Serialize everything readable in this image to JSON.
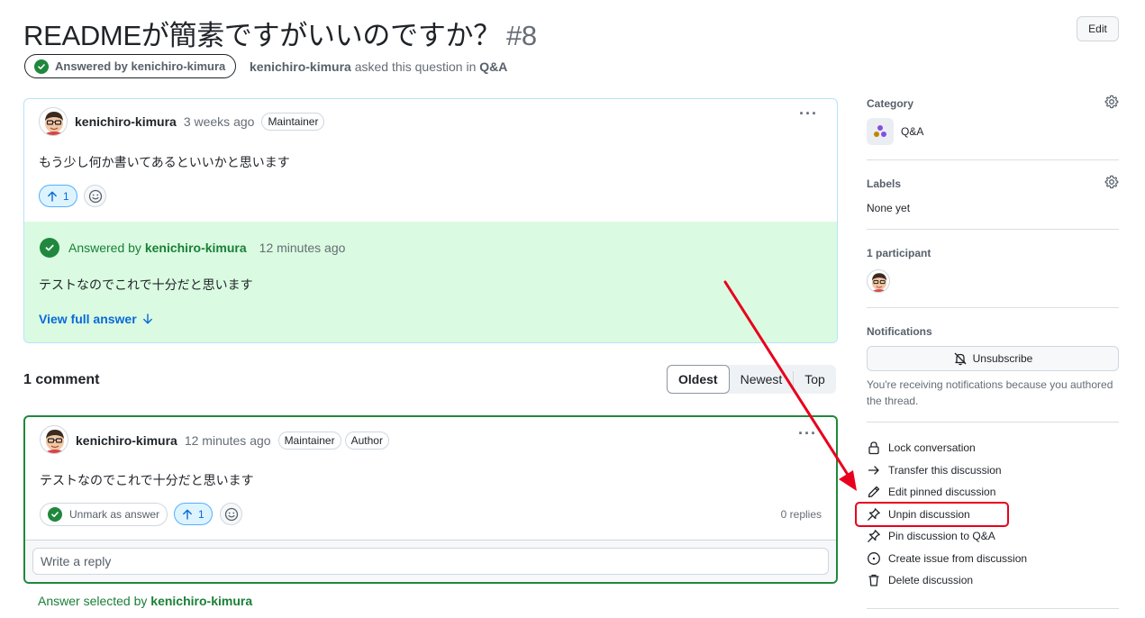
{
  "header": {
    "title": "READMEが簡素ですがいいのですか？",
    "number": "#8",
    "edit_label": "Edit",
    "answered_badge": "Answered by kenichiro-kimura",
    "author": "kenichiro-kimura",
    "asked_text": " asked this question in ",
    "category": "Q&A"
  },
  "question": {
    "author": "kenichiro-kimura",
    "time": "3 weeks ago",
    "badge": "Maintainer",
    "more_icon": "kebab-horizontal-icon",
    "body": "もう少し何か書いてあるといいかと思います",
    "upvotes": "1",
    "answer": {
      "prefix": "Answered by ",
      "author": "kenichiro-kimura",
      "time": "12 minutes ago",
      "body": "テストなのでこれで十分だと思います",
      "view_full": "View full answer"
    }
  },
  "comments": {
    "title": "1 comment",
    "sort": [
      "Oldest",
      "Newest",
      "Top"
    ],
    "items": [
      {
        "author": "kenichiro-kimura",
        "time": "12 minutes ago",
        "badges": [
          "Maintainer",
          "Author"
        ],
        "body": "テストなのでこれで十分だと思います",
        "unmark_label": "Unmark as answer",
        "upvotes": "1",
        "replies": "0 replies",
        "reply_placeholder": "Write a reply"
      }
    ],
    "answer_selected_prefix": "Answer selected by ",
    "answer_selected_author": "kenichiro-kimura"
  },
  "sidebar": {
    "category_heading": "Category",
    "category_name": "Q&A",
    "labels_heading": "Labels",
    "labels_value": "None yet",
    "participants_heading": "1 participant",
    "notifications_heading": "Notifications",
    "unsubscribe_label": "Unsubscribe",
    "notifications_text": "You're receiving notifications because you authored the thread.",
    "actions": [
      {
        "label": "Lock conversation",
        "icon": "lock-icon"
      },
      {
        "label": "Transfer this discussion",
        "icon": "arrow-right-icon"
      },
      {
        "label": "Edit pinned discussion",
        "icon": "pencil-icon"
      },
      {
        "label": "Unpin discussion",
        "icon": "pin-slash-icon"
      },
      {
        "label": "Pin discussion to Q&A",
        "icon": "pin-icon"
      },
      {
        "label": "Create issue from discussion",
        "icon": "issue-opened-icon"
      },
      {
        "label": "Delete discussion",
        "icon": "trash-icon"
      }
    ]
  },
  "colors": {
    "accent_blue": "#0969da",
    "success_green": "#1f883d",
    "answer_bg": "#dafbe1",
    "annotation_red": "#e8001c"
  }
}
